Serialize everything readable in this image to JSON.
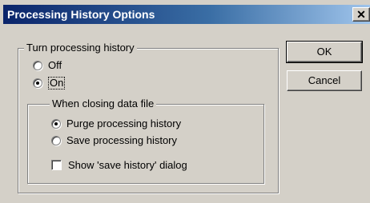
{
  "dialog": {
    "title": "Processing History Options",
    "close_glyph": "✕"
  },
  "group_main": {
    "legend": "Turn processing history",
    "options": [
      {
        "label": "Off",
        "checked": false
      },
      {
        "label": "On",
        "checked": true
      }
    ]
  },
  "group_sub": {
    "legend": "When closing data file",
    "options": [
      {
        "label": "Purge processing history",
        "checked": true
      },
      {
        "label": "Save processing history",
        "checked": false
      }
    ],
    "checkbox_label": "Show 'save history' dialog",
    "checkbox_checked": false
  },
  "buttons": {
    "ok": "OK",
    "cancel": "Cancel"
  }
}
